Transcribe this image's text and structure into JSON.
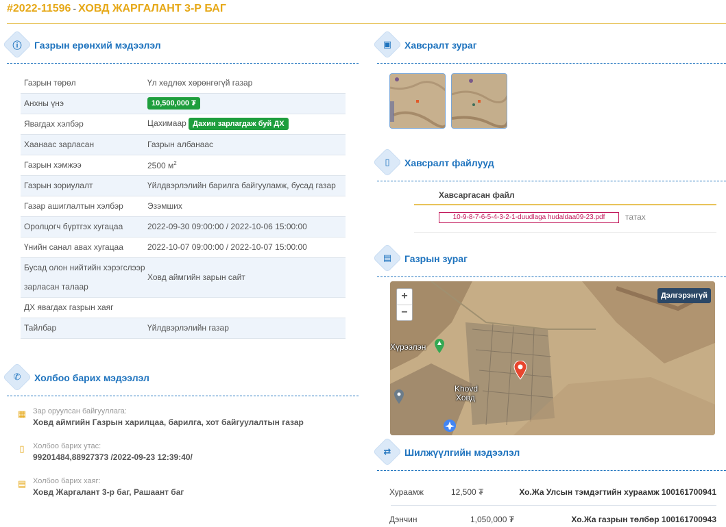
{
  "header": {
    "code": "#2022-11596",
    "separator": "-",
    "title": "ХОВД ЖАРГАЛАНТ 3-Р БАГ"
  },
  "general_info": {
    "heading": "Газрын ерөнхий мэдээлэл",
    "rows": [
      {
        "label": "Газрын төрөл",
        "value": "Үл хөдлөх хөрөнгөгүй газар"
      },
      {
        "label": "Анхны үнэ",
        "value": "10,500,000 ₮"
      },
      {
        "label": "Явагдах хэлбэр",
        "value": "Цахимаар",
        "tag": "Дахин зарлагдаж буй ДХ"
      },
      {
        "label": "Хаанаас зарласан",
        "value": "Газрын албанаас"
      },
      {
        "label": "Газрын хэмжээ",
        "value": "2500 м",
        "sup": "2"
      },
      {
        "label": "Газрын зориулалт",
        "value": "Үйлдвэрлэлийн барилга байгууламж, бусад газар"
      },
      {
        "label": "Газар ашиглалтын хэлбэр",
        "value": "Эзэмших"
      },
      {
        "label": "Оролцогч бүртгэх хугацаа",
        "value": "2022-09-30 09:00:00 / 2022-10-06 15:00:00"
      },
      {
        "label": "Үнийн санал авах хугацаа",
        "value": "2022-10-07 09:00:00 / 2022-10-07 15:00:00"
      },
      {
        "label_line1": "Бусад олон нийтийн хэрэгслээр",
        "label_line2": "зарласан талаар",
        "value": "Ховд аймгийн зарын сайт"
      },
      {
        "label": "ДХ явагдах газрын хаяг",
        "value": ""
      },
      {
        "label": "Тайлбар",
        "value": "Үйлдвэрлэлийн газар"
      }
    ]
  },
  "contact": {
    "heading": "Холбоо барих мэдээлэл",
    "items": [
      {
        "label": "Зар оруулсан байгууллага:",
        "value": "Ховд аймгийн Газрын харилцаа, барилга, хот байгуулалтын газар",
        "icon": "building-icon"
      },
      {
        "label": "Холбоо барих утас:",
        "value": "99201484,88927373 /2022-09-23 12:39:40/",
        "icon": "phone-icon"
      },
      {
        "label": "Холбоо барих хаяг:",
        "value": "Ховд Жаргалант 3-р баг, Рашаант баг",
        "icon": "map-icon"
      }
    ]
  },
  "attachments": {
    "images_heading": "Хавсралт зураг",
    "files_heading": "Хавсралт файлууд",
    "files_column": "Хавсаргасан файл",
    "file_name": "10-9-8-7-6-5-4-3-2-1-duudlaga hudaldaa09-23.pdf",
    "download_label": "татах"
  },
  "map": {
    "heading": "Газрын зураг",
    "zoom_in": "+",
    "zoom_out": "−",
    "detail_button": "Дэлгэрэнгүй",
    "place_label_1": "Khovd",
    "place_label_2": "Ховд",
    "place_label_3": "Хүрээлэн"
  },
  "transfers": {
    "heading": "Шилжүүлгийн мэдээлэл",
    "rows": [
      {
        "type": "Хураамж",
        "amount": "12,500 ₮",
        "account": "Хо.Жа Улсын тэмдэгтийн хураамж 100161700941"
      },
      {
        "type": "Дэнчин",
        "amount": "1,050,000 ₮",
        "account": "Хо.Жа газрын төлбөр 100161700943"
      }
    ]
  },
  "colors": {
    "accent": "#1e73be",
    "gold": "#e6a817",
    "green_tag": "#1e9e3d",
    "file_link": "#c2185b"
  }
}
